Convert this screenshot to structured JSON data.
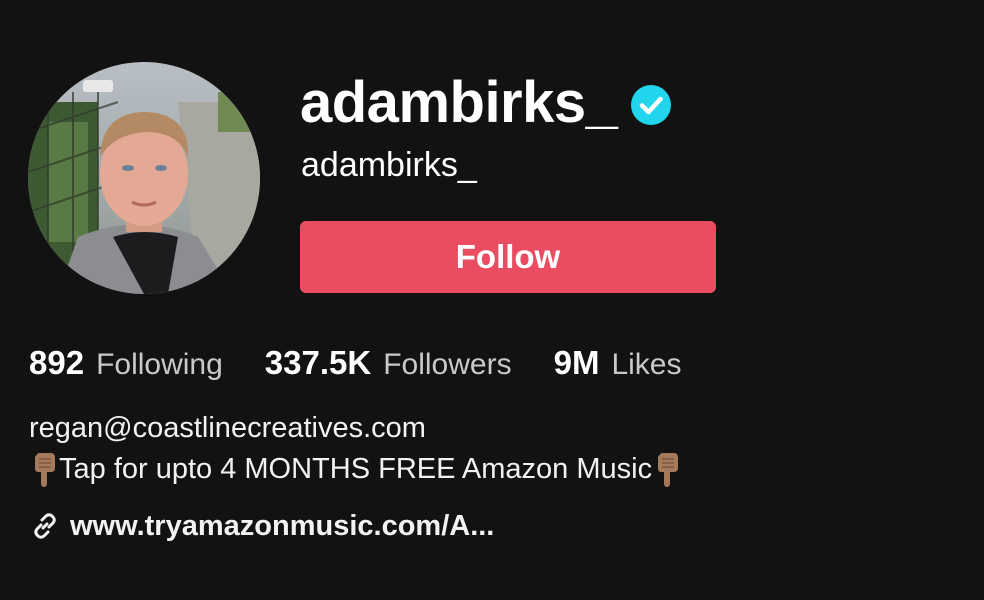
{
  "profile": {
    "username": "adambirks_",
    "handle": "adambirks_",
    "verified": true,
    "avatar_icon": "profile-photo"
  },
  "actions": {
    "follow_label": "Follow"
  },
  "stats": {
    "following": {
      "count": "892",
      "label": "Following"
    },
    "followers": {
      "count": "337.5K",
      "label": "Followers"
    },
    "likes": {
      "count": "9M",
      "label": "Likes"
    }
  },
  "bio": {
    "line1": "regan@coastlinecreatives.com",
    "line2_text": "Tap for upto 4 MONTHS FREE Amazon Music",
    "line2_icon": "pointing-down-hand-emoji"
  },
  "link": {
    "icon": "link-icon",
    "text": "www.tryamazonmusic.com/A..."
  },
  "colors": {
    "background": "#121212",
    "follow_button": "#ea4d62",
    "verified_badge": "#20d5ec",
    "stat_label": "#c9c9c9"
  }
}
